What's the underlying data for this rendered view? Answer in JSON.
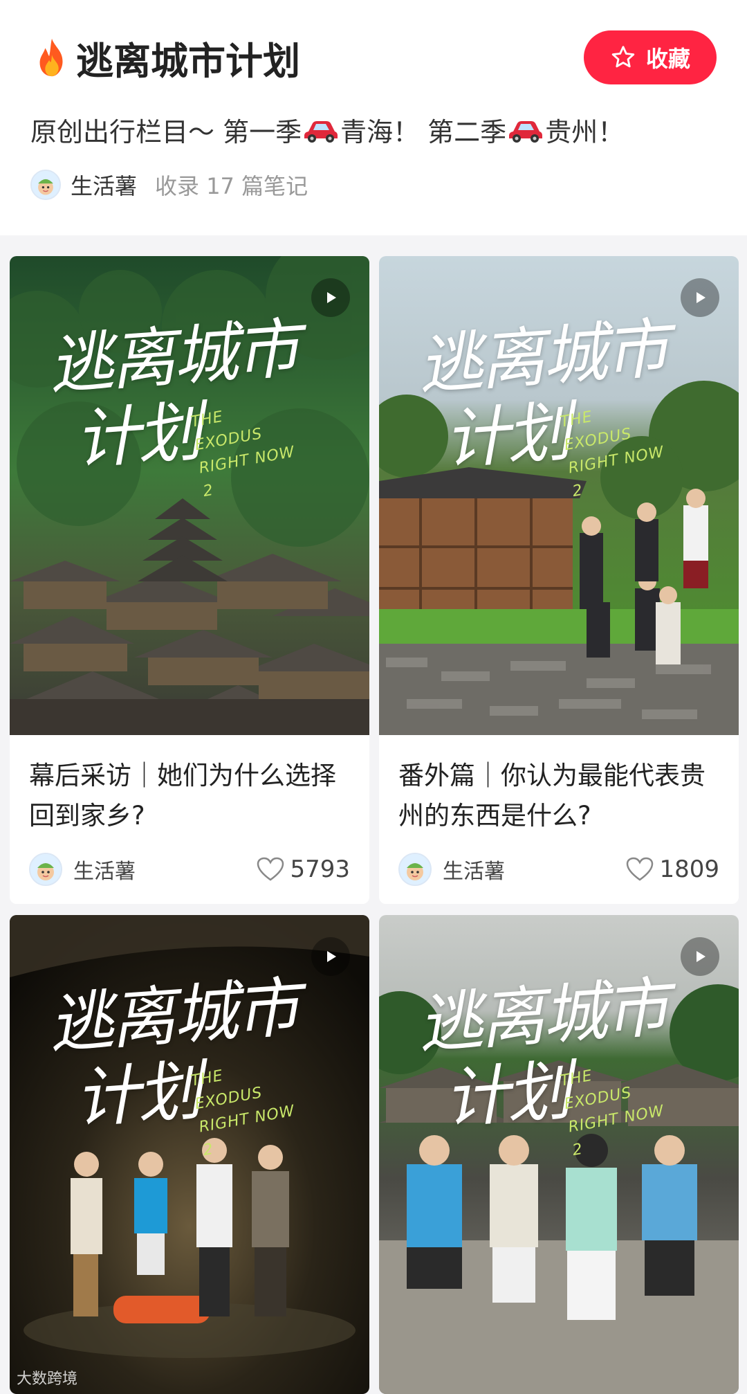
{
  "header": {
    "title": "逃离城市计划",
    "title_icon": "flame-icon",
    "collect_label": "收藏",
    "description_part1": "原创出行栏目～ 第一季",
    "description_part2": "青海！  第二季",
    "description_part3": "贵州！",
    "author": "生活薯",
    "note_count": "收录 17 篇笔记"
  },
  "cover_logo": {
    "line1": "逃离城市",
    "line2": "计划",
    "sub": "THE EXODUS RIGHT NOW 2"
  },
  "cards": [
    {
      "title": "幕后采访｜她们为什么选择回到家乡?",
      "author": "生活薯",
      "likes": "5793",
      "video": true
    },
    {
      "title": "番外篇｜你认为最能代表贵州的东西是什么?",
      "author": "生活薯",
      "likes": "1809",
      "video": true
    },
    {
      "title": "",
      "author": "",
      "likes": "",
      "video": true
    },
    {
      "title": "",
      "author": "",
      "likes": "",
      "video": true
    }
  ],
  "watermark": "大数跨境",
  "colors": {
    "accent": "#ff2442",
    "background": "#f4f4f6",
    "logo_sub": "#c9e86a"
  }
}
